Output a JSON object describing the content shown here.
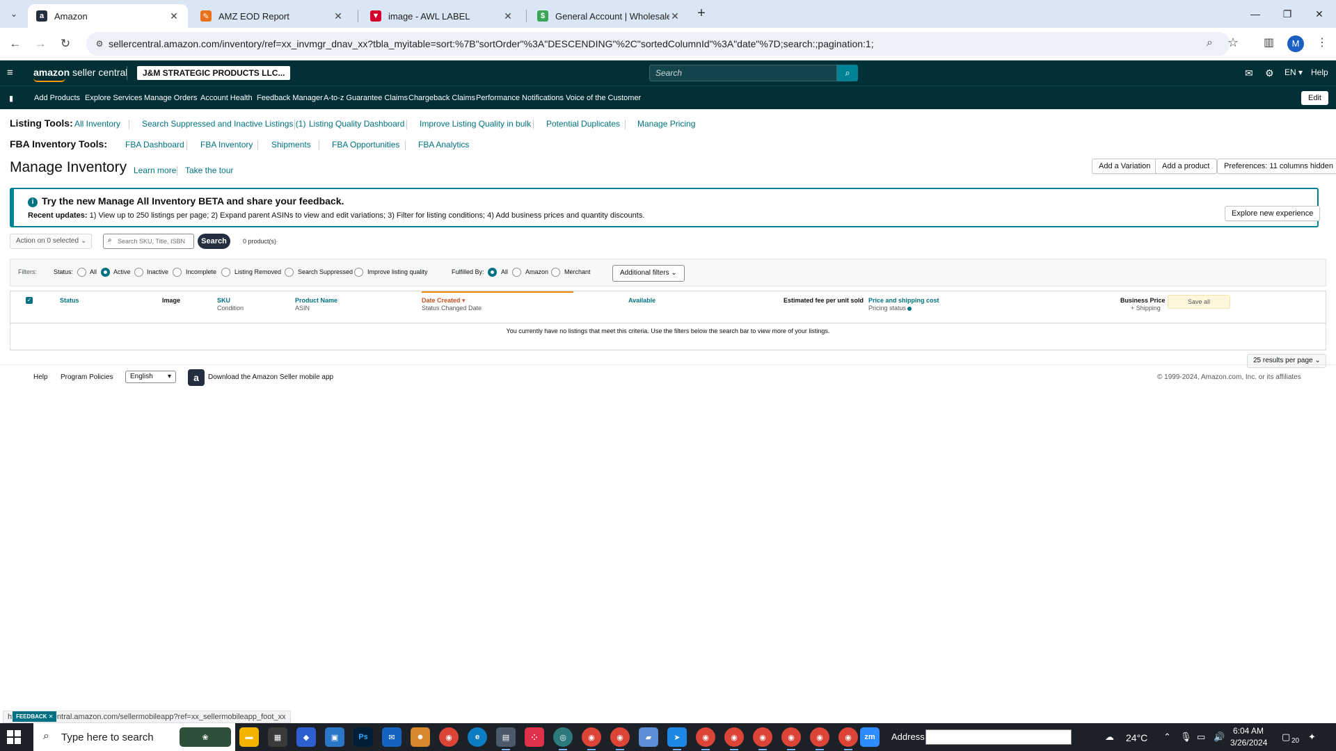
{
  "browser": {
    "tabs": [
      {
        "title": "Amazon",
        "favicon": "a",
        "favicon_color": "#232f3e",
        "active": true
      },
      {
        "title": "AMZ EOD Report",
        "favicon": "✎",
        "favicon_color": "#e8711a",
        "active": false
      },
      {
        "title": "image - AWL LABEL",
        "favicon": "▼",
        "favicon_color": "#d4002b",
        "active": false
      },
      {
        "title": "General Account | Wholesale",
        "favicon": "$",
        "favicon_color": "#3aa757",
        "active": false
      }
    ],
    "url": "sellercentral.amazon.com/inventory/ref=xx_invmgr_dnav_xx?tbla_myitable=sort:%7B\"sortOrder\"%3A\"DESCENDING\"%2C\"sortedColumnId\"%3A\"date\"%7D;search:;pagination:1;",
    "profile_initial": "M"
  },
  "header": {
    "logo_brand": "amazon",
    "logo_suffix": "seller central",
    "account_name": "J&M STRATEGIC PRODUCTS LLC...",
    "search_placeholder": "Search",
    "language": "EN",
    "help": "Help"
  },
  "nav": {
    "items": [
      "Add Products",
      "Explore Services",
      "Manage Orders",
      "Account Health",
      "Feedback Manager",
      "A-to-z Guarantee Claims",
      "Chargeback Claims",
      "Performance Notifications",
      "Voice of the Customer"
    ],
    "edit": "Edit"
  },
  "listing_tools": {
    "label": "Listing Tools:",
    "links": [
      "All Inventory",
      "Search Suppressed and Inactive Listings (1)",
      "Listing Quality Dashboard",
      "Improve Listing Quality in bulk",
      "Potential Duplicates",
      "Manage Pricing"
    ]
  },
  "fba_tools": {
    "label": "FBA Inventory Tools:",
    "links": [
      "FBA Dashboard",
      "FBA Inventory",
      "Shipments",
      "FBA Opportunities",
      "FBA Analytics"
    ]
  },
  "page": {
    "title": "Manage Inventory",
    "learn_more": "Learn more",
    "take_tour": "Take the tour",
    "add_variation": "Add a Variation",
    "add_product": "Add a product",
    "preferences": "Preferences: 11 columns hidden"
  },
  "banner": {
    "title": "Try the new Manage All Inventory BETA and share your feedback.",
    "updates_label": "Recent updates:",
    "updates_text": " 1) View up to 250 listings per page; 2) Expand parent ASINs to view and edit variations; 3) Filter for listing conditions; 4) Add business prices and quantity discounts.",
    "explore_button": "Explore new experience"
  },
  "search_row": {
    "action_label": "Action on 0 selected",
    "search_placeholder": "Search SKU, Title, ISBN",
    "search_button": "Search",
    "product_count": "0 product(s)"
  },
  "filters": {
    "label": "Filters:",
    "status_label": "Status:",
    "status_options": [
      "All",
      "Active",
      "Inactive",
      "Incomplete",
      "Listing Removed",
      "Search Suppressed",
      "Improve listing quality"
    ],
    "status_selected": "Active",
    "fulfilled_label": "Fulfilled By:",
    "fulfilled_options": [
      "All",
      "Amazon",
      "Merchant"
    ],
    "fulfilled_selected": "All",
    "additional_filters": "Additional filters"
  },
  "table": {
    "col_status": "Status",
    "col_image": "Image",
    "col_sku": "SKU",
    "col_sku_sub": "Condition",
    "col_product_name": "Product Name",
    "col_product_sub": "ASIN",
    "col_date_created": "Date Created",
    "col_date_sub": "Status Changed Date",
    "col_available": "Available",
    "col_fee": "Estimated fee per unit sold",
    "col_price": "Price and shipping cost",
    "col_price_sub": "Pricing status",
    "col_business_price": "Business Price",
    "col_business_sub": "+ Shipping",
    "save_all": "Save all",
    "empty_message": "You currently have no listings that meet this criteria. Use the filters below the search bar to view more of your listings.",
    "results_per_page": "25 results per page"
  },
  "footer": {
    "help": "Help",
    "program_policies": "Program Policies",
    "language": "English",
    "app_download": "Download the Amazon Seller mobile app",
    "copyright": "© 1999-2024, Amazon.com, Inc. or its affiliates"
  },
  "status_bar": {
    "url": "https://sellercentral.amazon.com/sellermobileapp?ref=xx_sellermobileapp_foot_xx",
    "feedback": "FEEDBACK"
  },
  "taskbar": {
    "search_placeholder": "Type here to search",
    "address_label": "Address",
    "temperature": "24°C",
    "time": "6:04 AM",
    "date": "3/26/2024",
    "notification_count": "20"
  },
  "colors": {
    "header_bg": "#002f36",
    "link": "#00727f",
    "accent": "#008296",
    "sort_active": "#c7511f",
    "taskbar_bg": "#1c2127"
  }
}
